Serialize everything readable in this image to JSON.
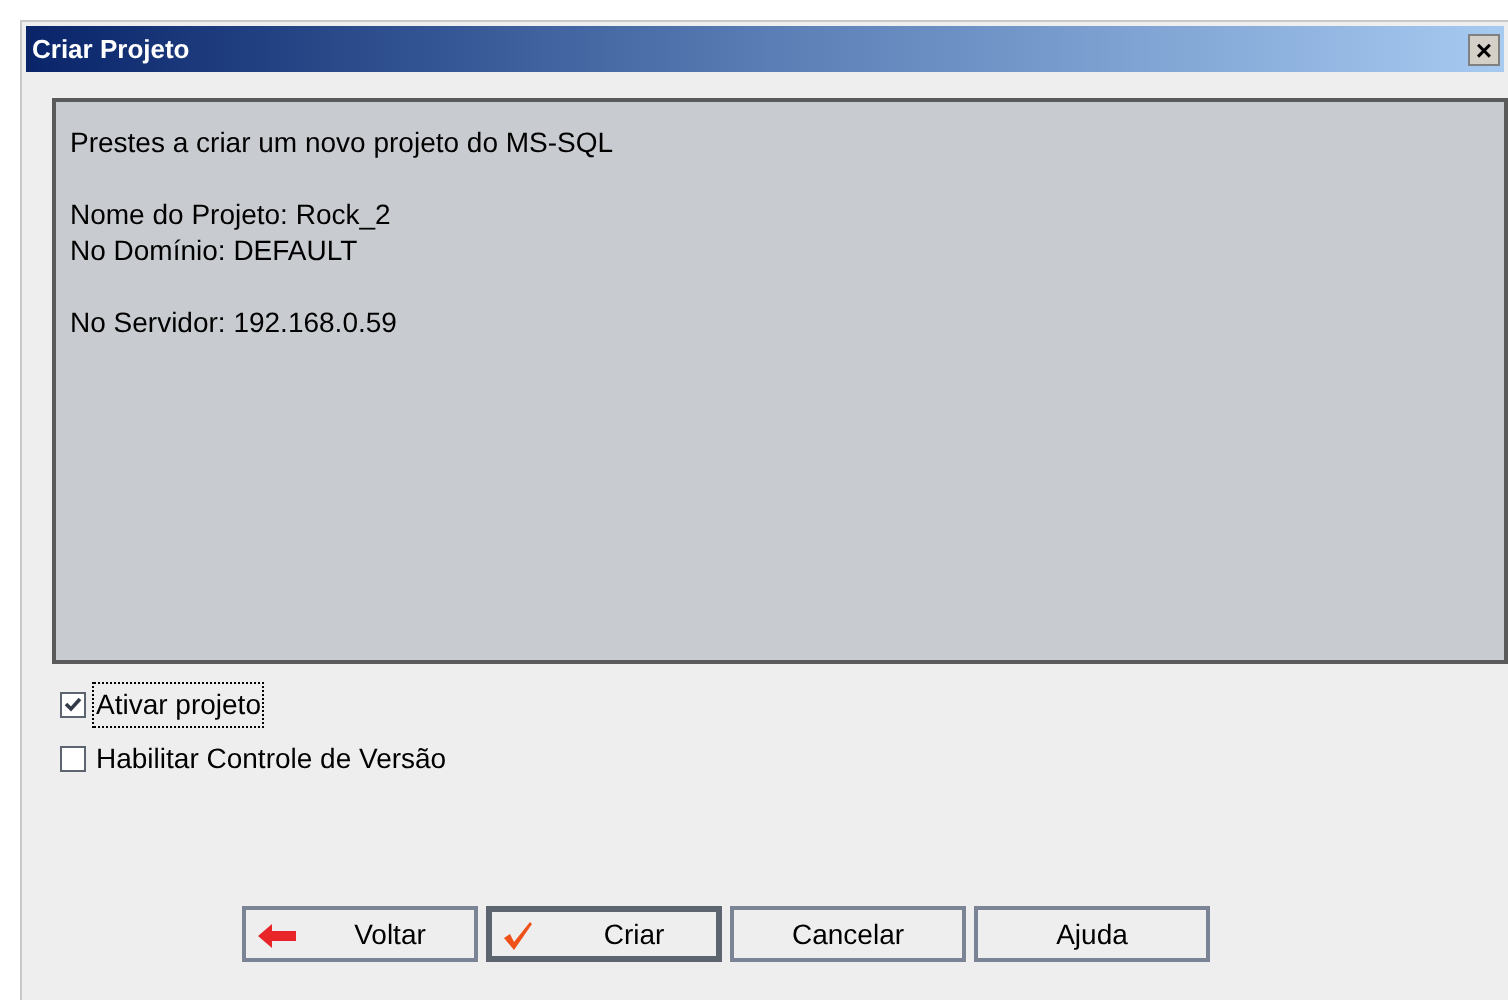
{
  "window": {
    "title": "Criar Projeto",
    "close": "×"
  },
  "summary": {
    "paragraphs": [
      [
        "Prestes a criar um novo projeto do MS-SQL"
      ],
      [
        "Nome do Projeto: Rock_2",
        "No Domínio: DEFAULT"
      ],
      [
        "No Servidor: 192.168.0.59"
      ]
    ]
  },
  "options": [
    {
      "label": "Ativar projeto",
      "checked": true,
      "focused": true
    },
    {
      "label": "Habilitar Controle de Versão",
      "checked": false,
      "focused": false
    }
  ],
  "buttons": [
    {
      "label": "Voltar",
      "kind": "back",
      "default": false
    },
    {
      "label": "Criar",
      "kind": "create",
      "default": true
    },
    {
      "label": "Cancelar",
      "kind": "plain",
      "default": false
    },
    {
      "label": "Ajuda",
      "kind": "plain",
      "default": false
    }
  ]
}
